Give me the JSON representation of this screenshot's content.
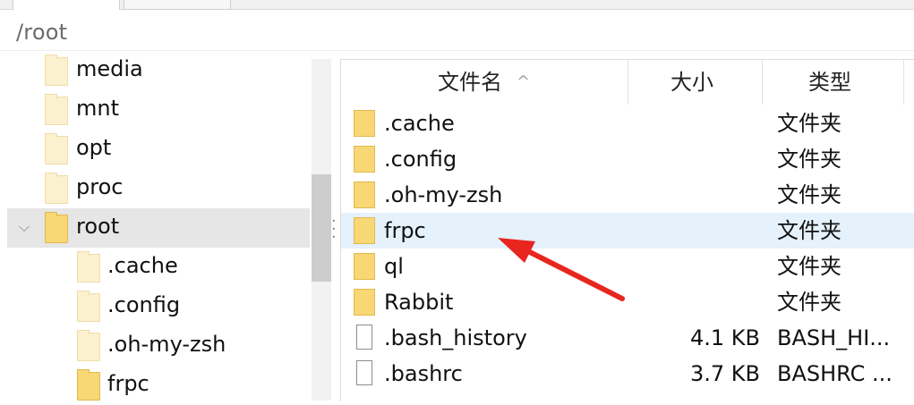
{
  "tabs": [
    "",
    "",
    ""
  ],
  "path": "/root",
  "tree": {
    "items": [
      {
        "label": "media",
        "expander": ""
      },
      {
        "label": "mnt",
        "expander": ""
      },
      {
        "label": "opt",
        "expander": ""
      },
      {
        "label": "proc",
        "expander": ""
      },
      {
        "label": "root",
        "expander": "⌵"
      },
      {
        "label": ".cache",
        "expander": ""
      },
      {
        "label": ".config",
        "expander": ""
      },
      {
        "label": ".oh-my-zsh",
        "expander": ""
      },
      {
        "label": "frpc",
        "expander": ""
      }
    ]
  },
  "list": {
    "columns": {
      "name": "文件名",
      "size": "大小",
      "type": "类型",
      "sort_indicator": "^"
    },
    "rows": [
      {
        "name": ".cache",
        "size": "",
        "type": "文件夹",
        "icon": "folder-icon"
      },
      {
        "name": ".config",
        "size": "",
        "type": "文件夹",
        "icon": "folder-icon"
      },
      {
        "name": ".oh-my-zsh",
        "size": "",
        "type": "文件夹",
        "icon": "folder-icon"
      },
      {
        "name": "frpc",
        "size": "",
        "type": "文件夹",
        "icon": "folder-icon"
      },
      {
        "name": "ql",
        "size": "",
        "type": "文件夹",
        "icon": "folder-icon"
      },
      {
        "name": "Rabbit",
        "size": "",
        "type": "文件夹",
        "icon": "folder-icon"
      },
      {
        "name": ".bash_history",
        "size": "4.1 KB",
        "type": "BASH_HI...",
        "icon": "file-icon"
      },
      {
        "name": ".bashrc",
        "size": "3.7 KB",
        "type": "BASHRC ...",
        "icon": "file-icon"
      }
    ]
  },
  "colors": {
    "folder": "#f8d775",
    "selected_row": "#e5f1fb",
    "arrow": "#e8251f"
  }
}
